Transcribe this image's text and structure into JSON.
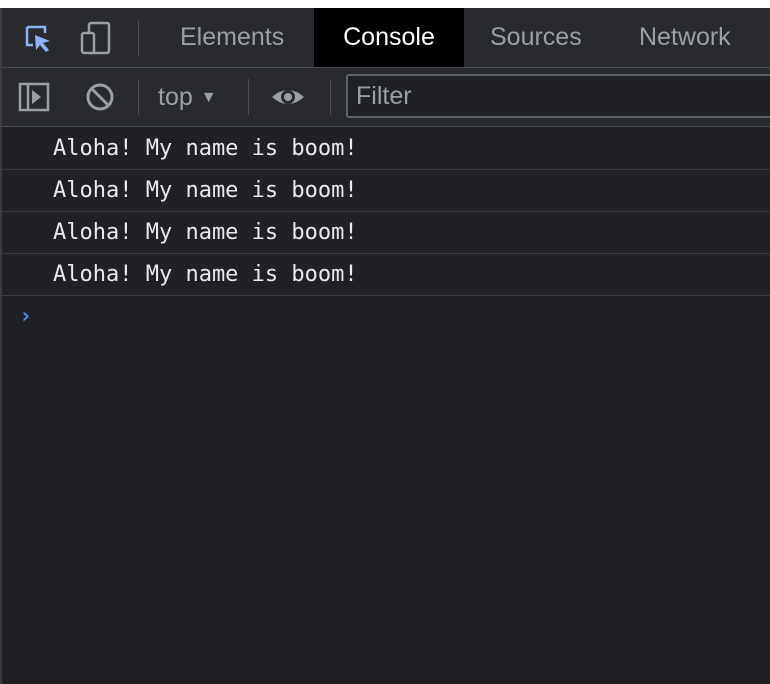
{
  "tabs": [
    {
      "label": "Elements",
      "active": false
    },
    {
      "label": "Console",
      "active": true
    },
    {
      "label": "Sources",
      "active": false
    },
    {
      "label": "Network",
      "active": false
    }
  ],
  "toolbar": {
    "context": "top",
    "filter_placeholder": "Filter"
  },
  "console": {
    "messages": [
      "Aloha! My name is boom!",
      "Aloha! My name is boom!",
      "Aloha! My name is boom!",
      "Aloha! My name is boom!"
    ],
    "prompt_symbol": "›"
  },
  "colors": {
    "background": "#202124",
    "toolbar": "#292a2d",
    "active_tab": "#000000",
    "prompt": "#4c8df6",
    "inspect_icon": "#8ab4f8"
  },
  "icons": [
    "inspect-element-icon",
    "device-toolbar-icon",
    "sidebar-toggle-icon",
    "clear-console-icon",
    "live-expression-eye-icon"
  ]
}
